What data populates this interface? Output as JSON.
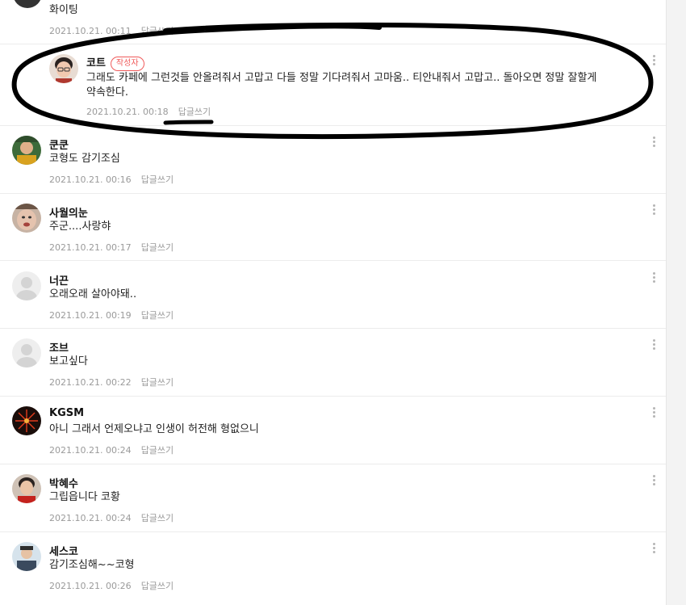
{
  "comments": [
    {
      "nick": "",
      "text": "화이팅",
      "date": "2021.10.21. 00:11",
      "reply": "답글쓰기"
    },
    {
      "nick": "코트",
      "badge": "작성자",
      "text": "그래도 카페에 그런것들 안올려줘서 고맙고 다들 정말 기다려줘서 고마움.. 티안내줘서 고맙고.. 돌아오면 정말 잘할게",
      "text2": "약속한다.",
      "date": "2021.10.21. 00:18",
      "reply": "답글쓰기"
    },
    {
      "nick": "쿤쿤",
      "text": "코형도 감기조심",
      "date": "2021.10.21. 00:16",
      "reply": "답글쓰기"
    },
    {
      "nick": "사월의눈",
      "text": "주군....사랑햐",
      "date": "2021.10.21. 00:17",
      "reply": "답글쓰기"
    },
    {
      "nick": "너끈",
      "text": "오래오래 살아야돼..",
      "date": "2021.10.21. 00:19",
      "reply": "답글쓰기"
    },
    {
      "nick": "조브",
      "text": "보고싶다",
      "date": "2021.10.21. 00:22",
      "reply": "답글쓰기"
    },
    {
      "nick": "KGSM",
      "text": "아니 그래서 언제오냐고 인생이 허전해 형없으니",
      "date": "2021.10.21. 00:24",
      "reply": "답글쓰기"
    },
    {
      "nick": "박혜수",
      "text": "그립읍니다 코황",
      "date": "2021.10.21. 00:24",
      "reply": "답글쓰기"
    },
    {
      "nick": "세스코",
      "text": "감기조심해~~코형",
      "date": "2021.10.21. 00:26",
      "reply": "답글쓰기"
    }
  ],
  "colors": {
    "badge": "#f05b5b",
    "meta": "#9a9a9a",
    "ink": "#000000"
  },
  "icons": {
    "more": "kebab-more-icon",
    "default_avatar": "default-profile-icon"
  }
}
